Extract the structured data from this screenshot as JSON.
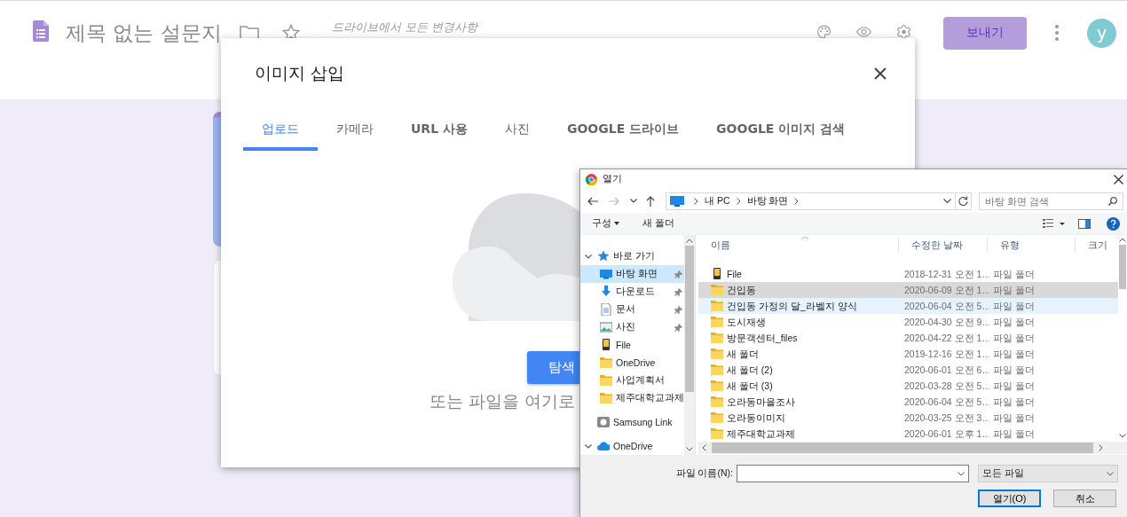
{
  "app_header": {
    "title": "제목 없는 설문지",
    "save_status": "드라이브에서 모든 변경사항",
    "send_button": "보내기",
    "avatar_letter": "y"
  },
  "insert_image_dialog": {
    "title": "이미지 삽입",
    "tabs": [
      {
        "label": "업로드",
        "selected": true
      },
      {
        "label": "카메라",
        "selected": false
      },
      {
        "label": "URL 사용",
        "selected": false
      },
      {
        "label": "사진",
        "selected": false
      },
      {
        "label": "GOOGLE 드라이브",
        "selected": false
      },
      {
        "label": "GOOGLE 이미지 검색",
        "selected": false
      }
    ],
    "browse_button": "탐색",
    "drop_hint": "또는 파일을 여기로"
  },
  "open_dialog": {
    "title": "열기",
    "breadcrumb": [
      "내 PC",
      "바탕 화면"
    ],
    "search": {
      "placeholder": "바탕 화면 검색"
    },
    "toolbar": [
      {
        "label": "구성",
        "menu": true
      },
      {
        "label": "새 폴더",
        "menu": false
      }
    ],
    "nav_tree": [
      {
        "label": "바로 가기",
        "kind": "star",
        "expanded": true,
        "selected": false,
        "children": [
          {
            "label": "바탕 화면",
            "kind": "desktop",
            "pinned": true,
            "selected": true
          },
          {
            "label": "다운로드",
            "kind": "download",
            "pinned": true,
            "selected": false
          },
          {
            "label": "문서",
            "kind": "document",
            "pinned": true,
            "selected": false
          },
          {
            "label": "사진",
            "kind": "image",
            "pinned": true,
            "selected": false
          },
          {
            "label": "File",
            "kind": "device",
            "pinned": false,
            "selected": false
          },
          {
            "label": "OneDrive",
            "kind": "folder",
            "pinned": false,
            "selected": false
          },
          {
            "label": "사업계획서",
            "kind": "folder",
            "pinned": false,
            "selected": false
          },
          {
            "label": "제주대학교과제",
            "kind": "folder",
            "pinned": false,
            "selected": false
          }
        ]
      },
      {
        "label": "Samsung Link",
        "kind": "drive",
        "selected": false
      },
      {
        "label": "OneDrive",
        "kind": "cloud",
        "expanded": true,
        "selected": false
      }
    ],
    "columns": [
      "이름",
      "수정한 날짜",
      "유형",
      "크기"
    ],
    "rows": [
      {
        "name": "File",
        "modified": "2018-12-31 오전 1…",
        "type": "파일 폴더",
        "kind": "device",
        "selected": false,
        "hovered": false
      },
      {
        "name": "건입동",
        "modified": "2020-06-09 오전 1…",
        "type": "파일 폴더",
        "kind": "folder",
        "selected": true,
        "hovered": false
      },
      {
        "name": "건입동 가정의 달_라벨지 양식",
        "modified": "2020-06-04 오전 5…",
        "type": "파일 폴더",
        "kind": "folder",
        "selected": false,
        "hovered": true
      },
      {
        "name": "도시재생",
        "modified": "2020-04-30 오전 9…",
        "type": "파일 폴더",
        "kind": "folder",
        "selected": false,
        "hovered": false
      },
      {
        "name": "방문객센터_files",
        "modified": "2020-04-22 오전 1…",
        "type": "파일 폴더",
        "kind": "folder",
        "selected": false,
        "hovered": false
      },
      {
        "name": "새 폴더",
        "modified": "2019-12-16 오전 1…",
        "type": "파일 폴더",
        "kind": "folder",
        "selected": false,
        "hovered": false
      },
      {
        "name": "새 폴더 (2)",
        "modified": "2020-06-01 오전 6…",
        "type": "파일 폴더",
        "kind": "folder",
        "selected": false,
        "hovered": false
      },
      {
        "name": "새 폴더 (3)",
        "modified": "2020-03-28 오전 5…",
        "type": "파일 폴더",
        "kind": "folder",
        "selected": false,
        "hovered": false
      },
      {
        "name": "오라동마을조사",
        "modified": "2020-06-04 오전 5…",
        "type": "파일 폴더",
        "kind": "folder",
        "selected": false,
        "hovered": false
      },
      {
        "name": "오라동이미지",
        "modified": "2020-03-25 오전 3…",
        "type": "파일 폴더",
        "kind": "folder",
        "selected": false,
        "hovered": false
      },
      {
        "name": "제주대학교과제",
        "modified": "2020-06-01 오후 1…",
        "type": "파일 폴더",
        "kind": "folder",
        "selected": false,
        "hovered": false
      }
    ],
    "filename_label": "파일 이름(N):",
    "file_type": "모든 파일",
    "buttons": [
      {
        "label": "열기(O)",
        "default": true
      },
      {
        "label": "취소",
        "default": false
      }
    ]
  }
}
